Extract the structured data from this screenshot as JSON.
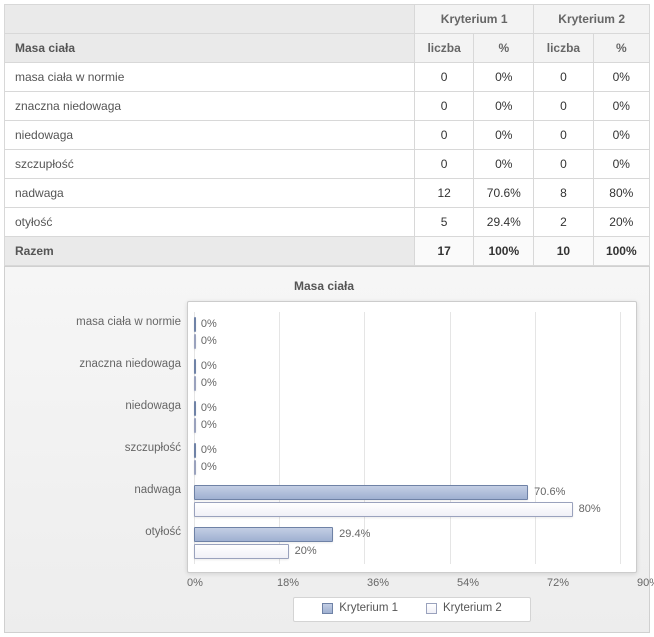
{
  "table": {
    "col_group_labels": [
      "Kryterium 1",
      "Kryterium 2"
    ],
    "sub_headers": [
      "liczba",
      "%",
      "liczba",
      "%"
    ],
    "section_header": "Masa ciała",
    "rows": [
      {
        "label": "masa ciała w normie",
        "cells": [
          "0",
          "0%",
          "0",
          "0%"
        ]
      },
      {
        "label": "znaczna niedowaga",
        "cells": [
          "0",
          "0%",
          "0",
          "0%"
        ]
      },
      {
        "label": "niedowaga",
        "cells": [
          "0",
          "0%",
          "0",
          "0%"
        ]
      },
      {
        "label": "szczupłość",
        "cells": [
          "0",
          "0%",
          "0",
          "0%"
        ]
      },
      {
        "label": "nadwaga",
        "cells": [
          "12",
          "70.6%",
          "8",
          "80%"
        ]
      },
      {
        "label": "otyłość",
        "cells": [
          "5",
          "29.4%",
          "2",
          "20%"
        ]
      }
    ],
    "total": {
      "label": "Razem",
      "cells": [
        "17",
        "100%",
        "10",
        "100%"
      ]
    }
  },
  "chart_data": {
    "type": "bar",
    "orientation": "horizontal",
    "title": "Masa ciała",
    "categories": [
      "masa ciała w normie",
      "znaczna niedowaga",
      "niedowaga",
      "szczupłość",
      "nadwaga",
      "otyłość"
    ],
    "series": [
      {
        "name": "Kryterium 1",
        "values": [
          0,
          0,
          0,
          0,
          70.6,
          29.4
        ]
      },
      {
        "name": "Kryterium 2",
        "values": [
          0,
          0,
          0,
          0,
          80,
          20
        ]
      }
    ],
    "value_labels": [
      [
        "0%",
        "0%",
        "0%",
        "0%",
        "70.6%",
        "29.4%"
      ],
      [
        "0%",
        "0%",
        "0%",
        "0%",
        "80%",
        "20%"
      ]
    ],
    "xlabel": "",
    "ylabel": "",
    "xlim": [
      0,
      90
    ],
    "xticks": [
      0,
      18,
      36,
      54,
      72,
      90
    ],
    "xtick_labels": [
      "0%",
      "18%",
      "36%",
      "54%",
      "72%",
      "90%"
    ],
    "legend_position": "bottom"
  }
}
